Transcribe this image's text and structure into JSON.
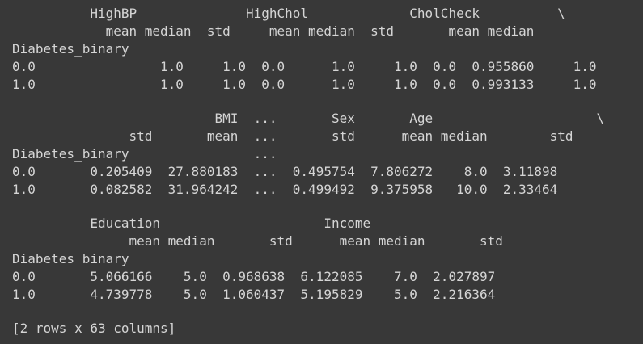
{
  "output": {
    "block1": {
      "header_top": "          HighBP              HighChol             CholCheck          \\",
      "header_stats": "            mean median  std     mean median  std       mean median",
      "index_name": "Diabetes_binary",
      "row_0": "0.0                1.0     1.0  0.0      1.0     1.0  0.0  0.955860     1.0",
      "row_1": "1.0                1.0     1.0  0.0      1.0     1.0  0.0  0.993133     1.0"
    },
    "block2": {
      "header_top": "                          BMI  ...       Sex       Age                     \\",
      "header_stats": "               std       mean  ...       std      mean median        std",
      "index_name": "Diabetes_binary                ...",
      "row_0": "0.0       0.205409  27.880183  ...  0.495754  7.806272    8.0  3.11898",
      "row_1": "1.0       0.082582  31.964242  ...  0.499492  9.375958   10.0  2.33464"
    },
    "block3": {
      "header_top": "          Education                     Income",
      "header_stats": "               mean median       std      mean median       std",
      "index_name": "Diabetes_binary",
      "row_0": "0.0       5.066166    5.0  0.968638  6.122085    7.0  2.027897",
      "row_1": "1.0       4.739778    5.0  1.060437  5.195829    5.0  2.216364"
    },
    "footer": "[2 rows x 63 columns]"
  }
}
